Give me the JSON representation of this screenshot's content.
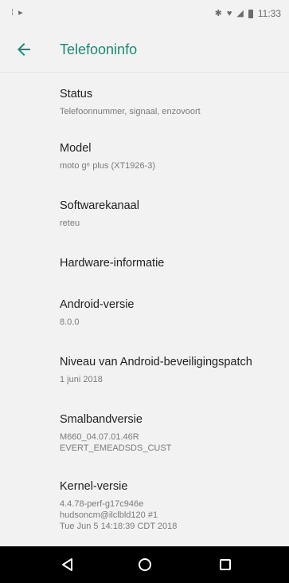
{
  "status_bar": {
    "left_icons": [
      "notification-dot-icon",
      "play-store-icon"
    ],
    "right_icons": [
      "bluetooth-icon",
      "wifi-icon",
      "signal-icon",
      "battery-icon"
    ],
    "time": "11:33"
  },
  "toolbar": {
    "title": "Telefooninfo",
    "back_icon": "back-arrow-icon"
  },
  "items": [
    {
      "title": "Status",
      "subtitle": "Telefoonnummer, signaal, enzovoort"
    },
    {
      "title": "Model",
      "subtitle": "moto g⁶ plus (XT1926-3)"
    },
    {
      "title": "Softwarekanaal",
      "subtitle": "reteu"
    },
    {
      "title": "Hardware-informatie",
      "subtitle": ""
    },
    {
      "title": "Android-versie",
      "subtitle": "8.0.0"
    },
    {
      "title": "Niveau van Android-beveiligingspatch",
      "subtitle": "1 juni 2018"
    },
    {
      "title": "Smalbandversie",
      "subtitle": "M660_04.07.01.46R\nEVERT_EMEADSDS_CUST"
    },
    {
      "title": "Kernel-versie",
      "subtitle": "4.4.78-perf-g17c946e\nhudsoncm@ilclbld120 #1\nTue Jun 5 14:18:39 CDT 2018"
    }
  ],
  "nav_bar": {
    "buttons": [
      "back-triangle-icon",
      "home-circle-icon",
      "recents-square-icon"
    ]
  },
  "colors": {
    "accent": "#1a8a78",
    "background": "#f2f2f2",
    "nav_bar": "#000000"
  }
}
